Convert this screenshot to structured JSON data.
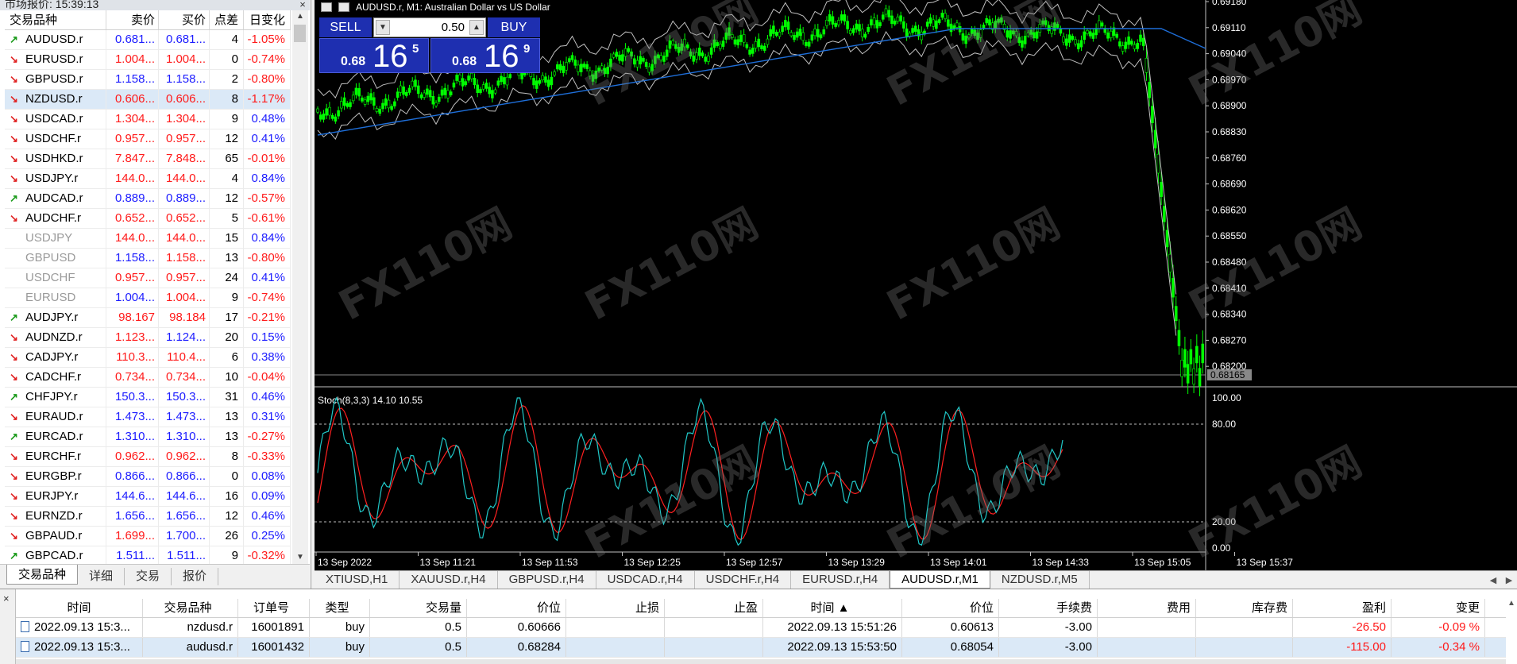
{
  "market_watch": {
    "title": "市场报价: 15:39:13",
    "close": "×",
    "headers": {
      "symbol": "交易品种",
      "bid": "卖价",
      "ask": "买价",
      "spread": "点差",
      "change": "日变化"
    },
    "rows": [
      {
        "dir": "up",
        "symbol": "AUDUSD.r",
        "bid": "0.681...",
        "ask": "0.681...",
        "spread": "4",
        "change": "-1.05%",
        "bidc": "blue",
        "askc": "blue",
        "chgc": "red"
      },
      {
        "dir": "down",
        "symbol": "EURUSD.r",
        "bid": "1.004...",
        "ask": "1.004...",
        "spread": "0",
        "change": "-0.74%",
        "bidc": "red",
        "askc": "red",
        "chgc": "red"
      },
      {
        "dir": "down",
        "symbol": "GBPUSD.r",
        "bid": "1.158...",
        "ask": "1.158...",
        "spread": "2",
        "change": "-0.80%",
        "bidc": "blue",
        "askc": "blue",
        "chgc": "red"
      },
      {
        "dir": "down",
        "symbol": "NZDUSD.r",
        "bid": "0.606...",
        "ask": "0.606...",
        "spread": "8",
        "change": "-1.17%",
        "bidc": "red",
        "askc": "red",
        "chgc": "red",
        "selected": true
      },
      {
        "dir": "down",
        "symbol": "USDCAD.r",
        "bid": "1.304...",
        "ask": "1.304...",
        "spread": "9",
        "change": "0.48%",
        "bidc": "red",
        "askc": "red",
        "chgc": "blue"
      },
      {
        "dir": "down",
        "symbol": "USDCHF.r",
        "bid": "0.957...",
        "ask": "0.957...",
        "spread": "12",
        "change": "0.41%",
        "bidc": "red",
        "askc": "red",
        "chgc": "blue"
      },
      {
        "dir": "down",
        "symbol": "USDHKD.r",
        "bid": "7.847...",
        "ask": "7.848...",
        "spread": "65",
        "change": "-0.01%",
        "bidc": "red",
        "askc": "red",
        "chgc": "red"
      },
      {
        "dir": "down",
        "symbol": "USDJPY.r",
        "bid": "144.0...",
        "ask": "144.0...",
        "spread": "4",
        "change": "0.84%",
        "bidc": "red",
        "askc": "red",
        "chgc": "blue"
      },
      {
        "dir": "up",
        "symbol": "AUDCAD.r",
        "bid": "0.889...",
        "ask": "0.889...",
        "spread": "12",
        "change": "-0.57%",
        "bidc": "blue",
        "askc": "blue",
        "chgc": "red"
      },
      {
        "dir": "down",
        "symbol": "AUDCHF.r",
        "bid": "0.652...",
        "ask": "0.652...",
        "spread": "5",
        "change": "-0.61%",
        "bidc": "red",
        "askc": "red",
        "chgc": "red"
      },
      {
        "dir": "none",
        "symbol": "USDJPY",
        "bid": "144.0...",
        "ask": "144.0...",
        "spread": "15",
        "change": "0.84%",
        "bidc": "red",
        "askc": "red",
        "chgc": "blue",
        "disabled": true
      },
      {
        "dir": "none",
        "symbol": "GBPUSD",
        "bid": "1.158...",
        "ask": "1.158...",
        "spread": "13",
        "change": "-0.80%",
        "bidc": "blue",
        "askc": "red",
        "chgc": "red",
        "disabled": true
      },
      {
        "dir": "none",
        "symbol": "USDCHF",
        "bid": "0.957...",
        "ask": "0.957...",
        "spread": "24",
        "change": "0.41%",
        "bidc": "red",
        "askc": "red",
        "chgc": "blue",
        "disabled": true
      },
      {
        "dir": "none",
        "symbol": "EURUSD",
        "bid": "1.004...",
        "ask": "1.004...",
        "spread": "9",
        "change": "-0.74%",
        "bidc": "blue",
        "askc": "red",
        "chgc": "red",
        "disabled": true
      },
      {
        "dir": "up",
        "symbol": "AUDJPY.r",
        "bid": "98.167",
        "ask": "98.184",
        "spread": "17",
        "change": "-0.21%",
        "bidc": "red",
        "askc": "red",
        "chgc": "red"
      },
      {
        "dir": "down",
        "symbol": "AUDNZD.r",
        "bid": "1.123...",
        "ask": "1.124...",
        "spread": "20",
        "change": "0.15%",
        "bidc": "red",
        "askc": "blue",
        "chgc": "blue"
      },
      {
        "dir": "down",
        "symbol": "CADJPY.r",
        "bid": "110.3...",
        "ask": "110.4...",
        "spread": "6",
        "change": "0.38%",
        "bidc": "red",
        "askc": "red",
        "chgc": "blue"
      },
      {
        "dir": "down",
        "symbol": "CADCHF.r",
        "bid": "0.734...",
        "ask": "0.734...",
        "spread": "10",
        "change": "-0.04%",
        "bidc": "red",
        "askc": "red",
        "chgc": "red"
      },
      {
        "dir": "up",
        "symbol": "CHFJPY.r",
        "bid": "150.3...",
        "ask": "150.3...",
        "spread": "31",
        "change": "0.46%",
        "bidc": "blue",
        "askc": "blue",
        "chgc": "blue"
      },
      {
        "dir": "down",
        "symbol": "EURAUD.r",
        "bid": "1.473...",
        "ask": "1.473...",
        "spread": "13",
        "change": "0.31%",
        "bidc": "blue",
        "askc": "blue",
        "chgc": "blue"
      },
      {
        "dir": "up",
        "symbol": "EURCAD.r",
        "bid": "1.310...",
        "ask": "1.310...",
        "spread": "13",
        "change": "-0.27%",
        "bidc": "blue",
        "askc": "blue",
        "chgc": "red"
      },
      {
        "dir": "down",
        "symbol": "EURCHF.r",
        "bid": "0.962...",
        "ask": "0.962...",
        "spread": "8",
        "change": "-0.33%",
        "bidc": "red",
        "askc": "red",
        "chgc": "red"
      },
      {
        "dir": "down",
        "symbol": "EURGBP.r",
        "bid": "0.866...",
        "ask": "0.866...",
        "spread": "0",
        "change": "0.08%",
        "bidc": "blue",
        "askc": "blue",
        "chgc": "blue"
      },
      {
        "dir": "down",
        "symbol": "EURJPY.r",
        "bid": "144.6...",
        "ask": "144.6...",
        "spread": "16",
        "change": "0.09%",
        "bidc": "blue",
        "askc": "blue",
        "chgc": "blue"
      },
      {
        "dir": "down",
        "symbol": "EURNZD.r",
        "bid": "1.656...",
        "ask": "1.656...",
        "spread": "12",
        "change": "0.46%",
        "bidc": "blue",
        "askc": "blue",
        "chgc": "blue"
      },
      {
        "dir": "down",
        "symbol": "GBPAUD.r",
        "bid": "1.699...",
        "ask": "1.700...",
        "spread": "26",
        "change": "0.25%",
        "bidc": "red",
        "askc": "blue",
        "chgc": "blue"
      },
      {
        "dir": "up",
        "symbol": "GBPCAD.r",
        "bid": "1.511...",
        "ask": "1.511...",
        "spread": "9",
        "change": "-0.32%",
        "bidc": "blue",
        "askc": "blue",
        "chgc": "red"
      }
    ],
    "tabs": [
      "交易品种",
      "详细",
      "交易",
      "报价"
    ],
    "active_tab": 0
  },
  "chart": {
    "title": "AUDUSD.r, M1:  Australian Dollar vs US Dollar",
    "trade_panel": {
      "sell_label": "SELL",
      "buy_label": "BUY",
      "volume": "0.50",
      "bid_prefix": "0.68",
      "bid_big": "16",
      "bid_sup": "5",
      "ask_prefix": "0.68",
      "ask_big": "16",
      "ask_sup": "9"
    },
    "price_axis": [
      "0.69180",
      "0.69110",
      "0.69040",
      "0.68970",
      "0.68900",
      "0.68830",
      "0.68760",
      "0.68690",
      "0.68620",
      "0.68550",
      "0.68480",
      "0.68410",
      "0.68340",
      "0.68270",
      "0.68200"
    ],
    "current_price": "0.68165",
    "indicator_label": "Stoch(8,3,3) 14.10 10.55",
    "indicator_axis": [
      "100.00",
      "80.00",
      "20.00",
      "0.00"
    ],
    "time_axis": [
      "13 Sep 2022",
      "13 Sep 11:21",
      "13 Sep 11:53",
      "13 Sep 12:25",
      "13 Sep 12:57",
      "13 Sep 13:29",
      "13 Sep 14:01",
      "13 Sep 14:33",
      "13 Sep 15:05",
      "13 Sep 15:37"
    ],
    "watermark": "FX110网",
    "colors": {
      "bull": "#00ff00",
      "ma": "#1e6ed8",
      "bands": "#c0c0c0",
      "stoch_main": "#20c8c8",
      "stoch_signal": "#ff2020"
    }
  },
  "chart_tabs": [
    "XTIUSD,H1",
    "XAUUSD.r,H4",
    "GBPUSD.r,H4",
    "USDCAD.r,H4",
    "USDCHF.r,H4",
    "EURUSD.r,H4",
    "AUDUSD.r,M1",
    "NZDUSD.r,M5"
  ],
  "chart_tabs_active": 6,
  "terminal": {
    "close": "×",
    "headers": [
      "时间",
      "交易品种",
      "订单号",
      "类型",
      "交易量",
      "价位",
      "止损",
      "止盈",
      "时间 ▲",
      "价位",
      "手续费",
      "费用",
      "库存费",
      "盈利",
      "变更"
    ],
    "rows": [
      [
        "2022.09.13 15:3...",
        "nzdusd.r",
        "16001891",
        "buy",
        "0.5",
        "0.60666",
        "",
        "",
        "2022.09.13 15:51:26",
        "0.60613",
        "-3.00",
        "",
        "",
        "-26.50",
        "-0.09 %"
      ],
      [
        "2022.09.13 15:3...",
        "audusd.r",
        "16001432",
        "buy",
        "0.5",
        "0.68284",
        "",
        "",
        "2022.09.13 15:53:50",
        "0.68054",
        "-3.00",
        "",
        "",
        "-115.00",
        "-0.34 %"
      ]
    ]
  }
}
